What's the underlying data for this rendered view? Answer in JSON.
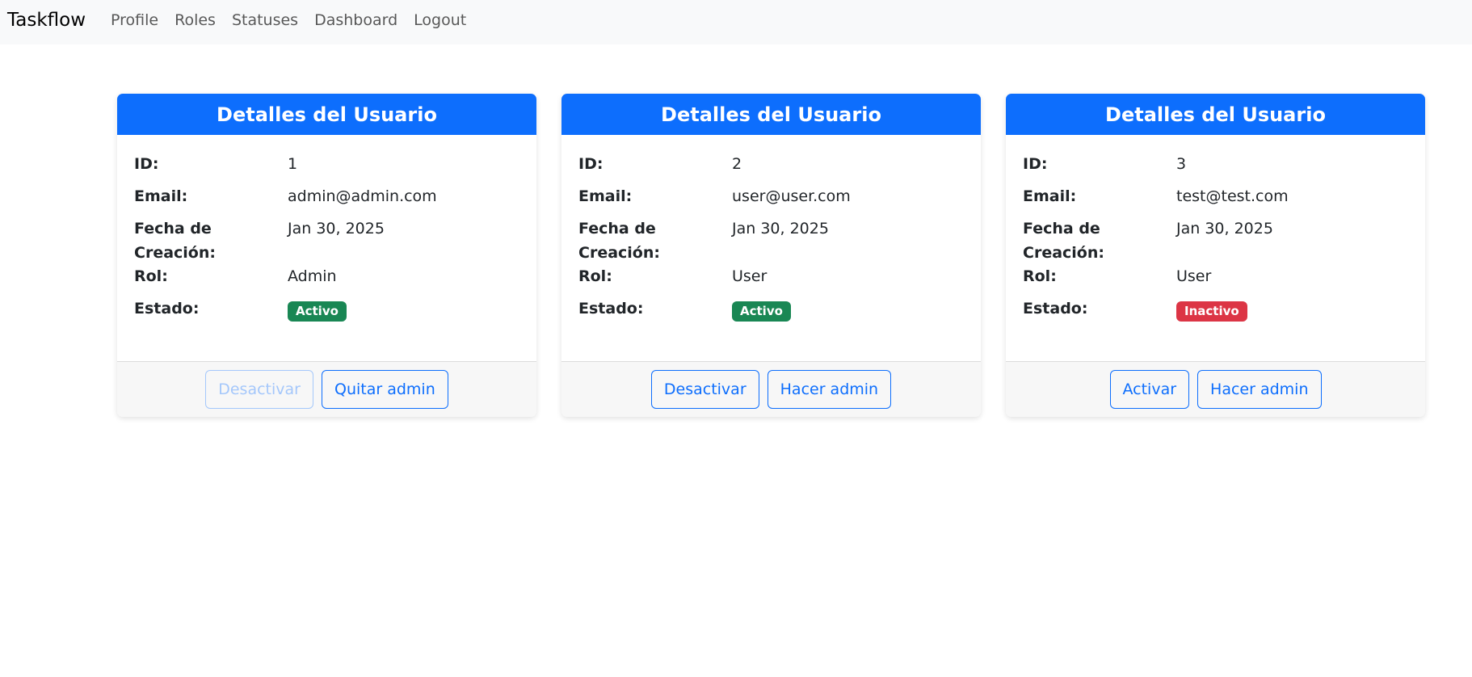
{
  "navbar": {
    "brand": "Taskflow",
    "links": [
      "Profile",
      "Roles",
      "Statuses",
      "Dashboard",
      "Logout"
    ]
  },
  "colors": {
    "primary": "#0d6efd",
    "success": "#198754",
    "danger": "#dc3545"
  },
  "labels": {
    "card_title": "Detalles del Usuario",
    "id": "ID:",
    "email": "Email:",
    "fecha_line1": "Fecha de",
    "fecha_line2": "Creación:",
    "rol": "Rol:",
    "estado": "Estado:"
  },
  "users": [
    {
      "id": "1",
      "email": "admin@admin.com",
      "fecha": "Jan 30, 2025",
      "rol": "Admin",
      "estado": "Activo",
      "estado_color": "#198754",
      "action1": "Desactivar",
      "action1_disabled": true,
      "action2": "Quitar admin"
    },
    {
      "id": "2",
      "email": "user@user.com",
      "fecha": "Jan 30, 2025",
      "rol": "User",
      "estado": "Activo",
      "estado_color": "#198754",
      "action1": "Desactivar",
      "action1_disabled": false,
      "action2": "Hacer admin"
    },
    {
      "id": "3",
      "email": "test@test.com",
      "fecha": "Jan 30, 2025",
      "rol": "User",
      "estado": "Inactivo",
      "estado_color": "#dc3545",
      "action1": "Activar",
      "action1_disabled": false,
      "action2": "Hacer admin"
    }
  ]
}
